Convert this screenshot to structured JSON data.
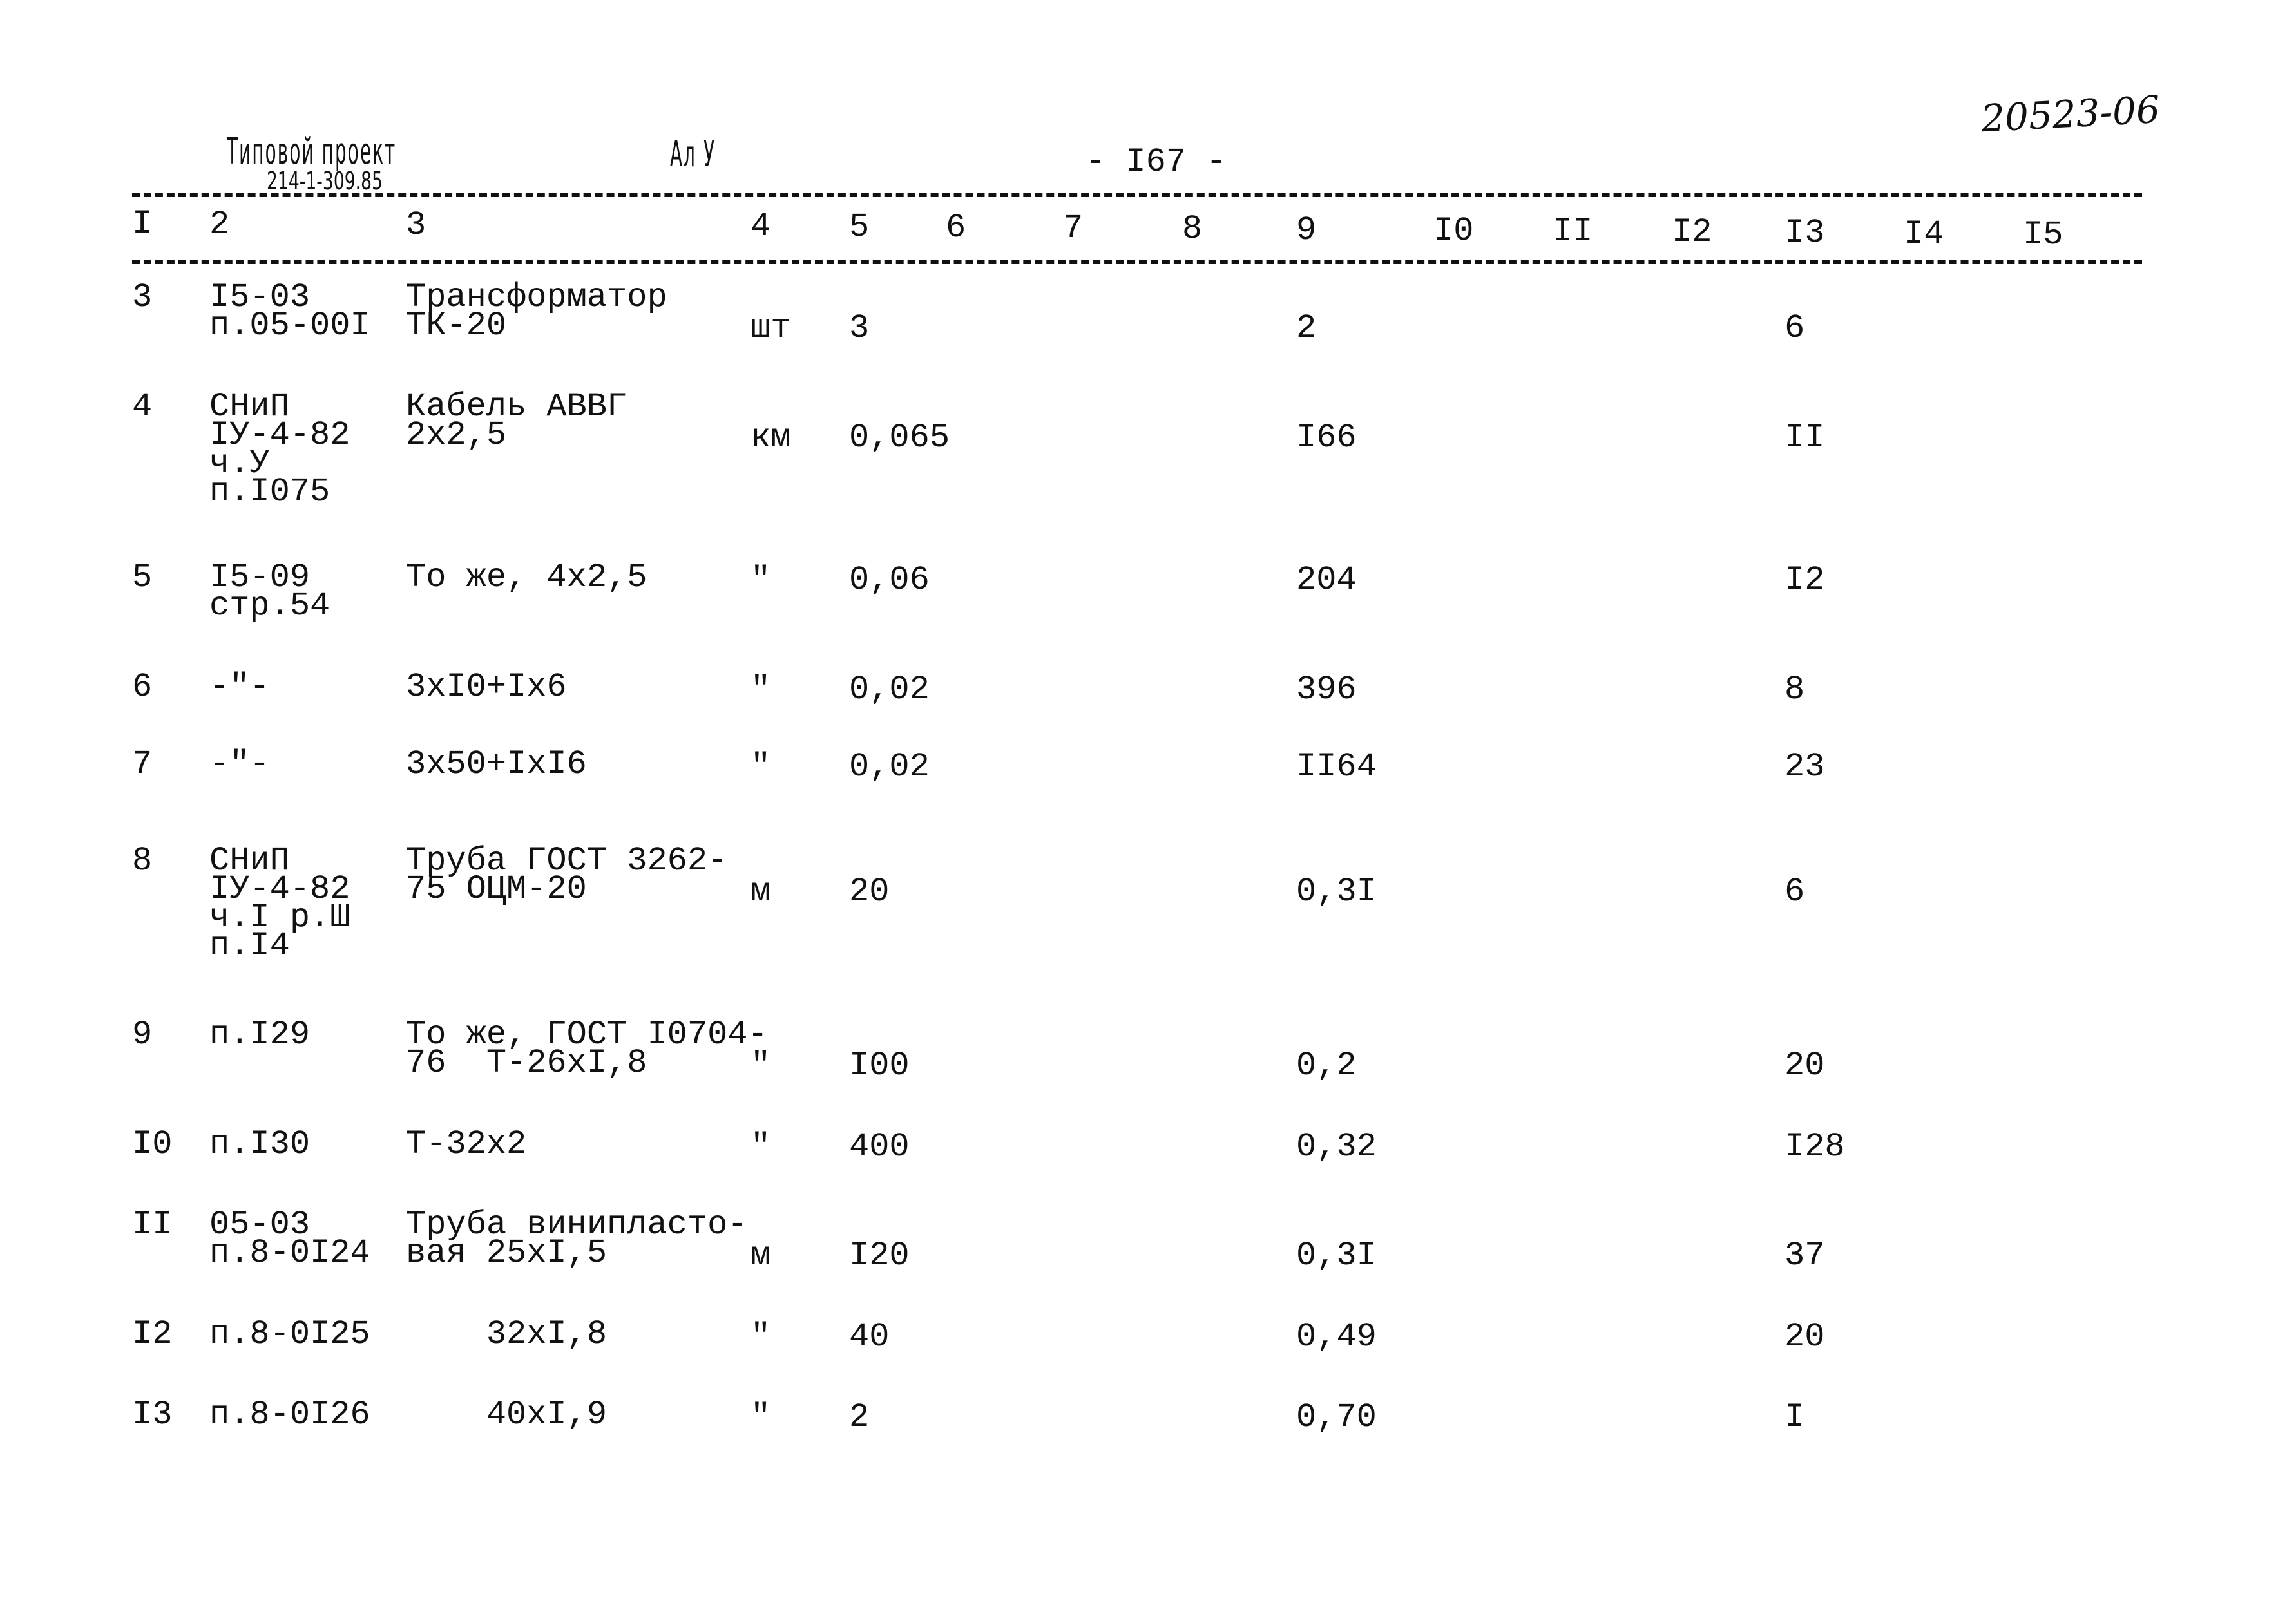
{
  "header": {
    "stamp_title": "Типовой проект",
    "stamp_code": "214-1-309.85",
    "album": "Ал У",
    "page_number": "- I67 -",
    "archive_number": "20523-06"
  },
  "columns": [
    "I",
    "2",
    "3",
    "4",
    "5",
    "6",
    "7",
    "8",
    "9",
    "I0",
    "II",
    "I2",
    "I3",
    "I4",
    "I5"
  ],
  "rows": [
    {
      "n": "3",
      "ref": "I5-03\nп.05-00I",
      "name": "Трансформатор\nТК-20",
      "unit": "шт",
      "qty": "3",
      "c9": "2",
      "c13": "6"
    },
    {
      "n": "4",
      "ref": "СНиП\nIУ-4-82\nч.У\nп.I075",
      "name": "Кабель АВВГ\n2х2,5",
      "unit": "км",
      "qty": "0,065",
      "c9": "I66",
      "c13": "II"
    },
    {
      "n": "5",
      "ref": "I5-09\nстр.54",
      "name": "То же, 4х2,5",
      "unit": "\"",
      "qty": "0,06",
      "c9": "204",
      "c13": "I2"
    },
    {
      "n": "6",
      "ref": "-\"-",
      "name": "3хI0+Iх6",
      "unit": "\"",
      "qty": "0,02",
      "c9": "396",
      "c13": "8"
    },
    {
      "n": "7",
      "ref": "-\"-",
      "name": "3х50+IхI6",
      "unit": "\"",
      "qty": "0,02",
      "c9": "II64",
      "c13": "23"
    },
    {
      "n": "8",
      "ref": "СНиП\nIУ-4-82\nч.I р.Ш\nп.I4",
      "name": "Труба ГОСТ 3262-\n75 ОЦМ-20",
      "unit": "м",
      "qty": "20",
      "c9": "0,3I",
      "c13": "6"
    },
    {
      "n": "9",
      "ref": "п.I29",
      "name": "То же, ГОСТ I0704-\n76  Т-26хI,8",
      "unit": "\"",
      "qty": "I00",
      "c9": "0,2",
      "c13": "20"
    },
    {
      "n": "I0",
      "ref": "п.I30",
      "name": "Т-32х2",
      "unit": "\"",
      "qty": "400",
      "c9": "0,32",
      "c13": "I28"
    },
    {
      "n": "II",
      "ref": "05-03\nп.8-0I24",
      "name": "Труба винипласто-\nвая 25хI,5",
      "unit": "м",
      "qty": "I20",
      "c9": "0,3I",
      "c13": "37"
    },
    {
      "n": "I2",
      "ref": "п.8-0I25",
      "name": "    32хI,8",
      "unit": "\"",
      "qty": "40",
      "c9": "0,49",
      "c13": "20"
    },
    {
      "n": "I3",
      "ref": "п.8-0I26",
      "name": "    40хI,9",
      "unit": "\"",
      "qty": "2",
      "c9": "0,70",
      "c13": "I"
    }
  ]
}
